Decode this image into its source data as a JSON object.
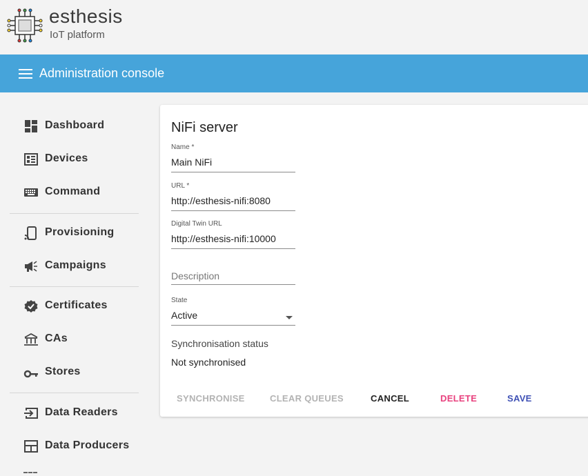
{
  "brand": {
    "name": "esthesis",
    "tagline": "IoT platform"
  },
  "topbar": {
    "title": "Administration console"
  },
  "sidebar": {
    "items": [
      {
        "label": "Dashboard",
        "icon": "dashboard-icon"
      },
      {
        "label": "Devices",
        "icon": "devices-icon"
      },
      {
        "label": "Command",
        "icon": "keyboard-icon"
      },
      {
        "label": "Provisioning",
        "icon": "phone-cast-icon"
      },
      {
        "label": "Campaigns",
        "icon": "megaphone-icon"
      },
      {
        "label": "Certificates",
        "icon": "verified-badge-icon"
      },
      {
        "label": "CAs",
        "icon": "account-balance-icon"
      },
      {
        "label": "Stores",
        "icon": "key-icon"
      },
      {
        "label": "Data Readers",
        "icon": "input-icon"
      },
      {
        "label": "Data Producers",
        "icon": "layout-icon"
      }
    ]
  },
  "form": {
    "title": "NiFi server",
    "name": {
      "label": "Name *",
      "value": "Main NiFi"
    },
    "url": {
      "label": "URL *",
      "value": "http://esthesis-nifi:8080"
    },
    "twin": {
      "label": "Digital Twin URL",
      "value": "http://esthesis-nifi:10000"
    },
    "description": {
      "placeholder": "Description"
    },
    "state": {
      "label": "State",
      "value": "Active"
    },
    "sync": {
      "label": "Synchronisation status",
      "value": "Not synchronised"
    }
  },
  "actions": {
    "synchronise": "SYNCHRONISE",
    "clear_queues": "CLEAR QUEUES",
    "cancel": "CANCEL",
    "delete": "DELETE",
    "save": "SAVE"
  },
  "colors": {
    "topbar": "#46a4da",
    "delete": "#e8417e",
    "save": "#3f51b5",
    "disabled": "#b3b3b3"
  }
}
